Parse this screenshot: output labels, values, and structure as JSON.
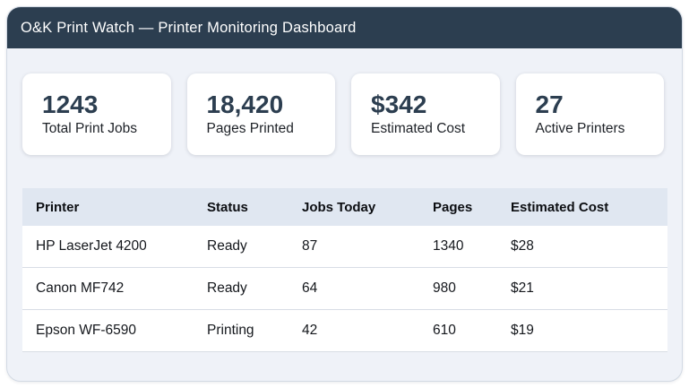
{
  "app": {
    "title": "O&K Print Watch — Printer Monitoring Dashboard"
  },
  "stats": [
    {
      "value": "1243",
      "label": "Total Print Jobs"
    },
    {
      "value": "18,420",
      "label": "Pages Printed"
    },
    {
      "value": "$342",
      "label": "Estimated Cost"
    },
    {
      "value": "27",
      "label": "Active Printers"
    }
  ],
  "table": {
    "columns": [
      "Printer",
      "Status",
      "Jobs Today",
      "Pages",
      "Estimated Cost"
    ],
    "rows": [
      [
        "HP LaserJet 4200",
        "Ready",
        "87",
        "1340",
        "$28"
      ],
      [
        "Canon MF742",
        "Ready",
        "64",
        "980",
        "$21"
      ],
      [
        "Epson WF-6590",
        "Printing",
        "42",
        "610",
        "$19"
      ]
    ]
  },
  "colors": {
    "appbar_bg": "#2c3e50",
    "appbar_text": "#ffffff",
    "panel_bg": "#eff2f8",
    "stat_value": "#2c3e50",
    "table_header_bg": "#e0e7f1",
    "row_border": "#d8dde5"
  }
}
